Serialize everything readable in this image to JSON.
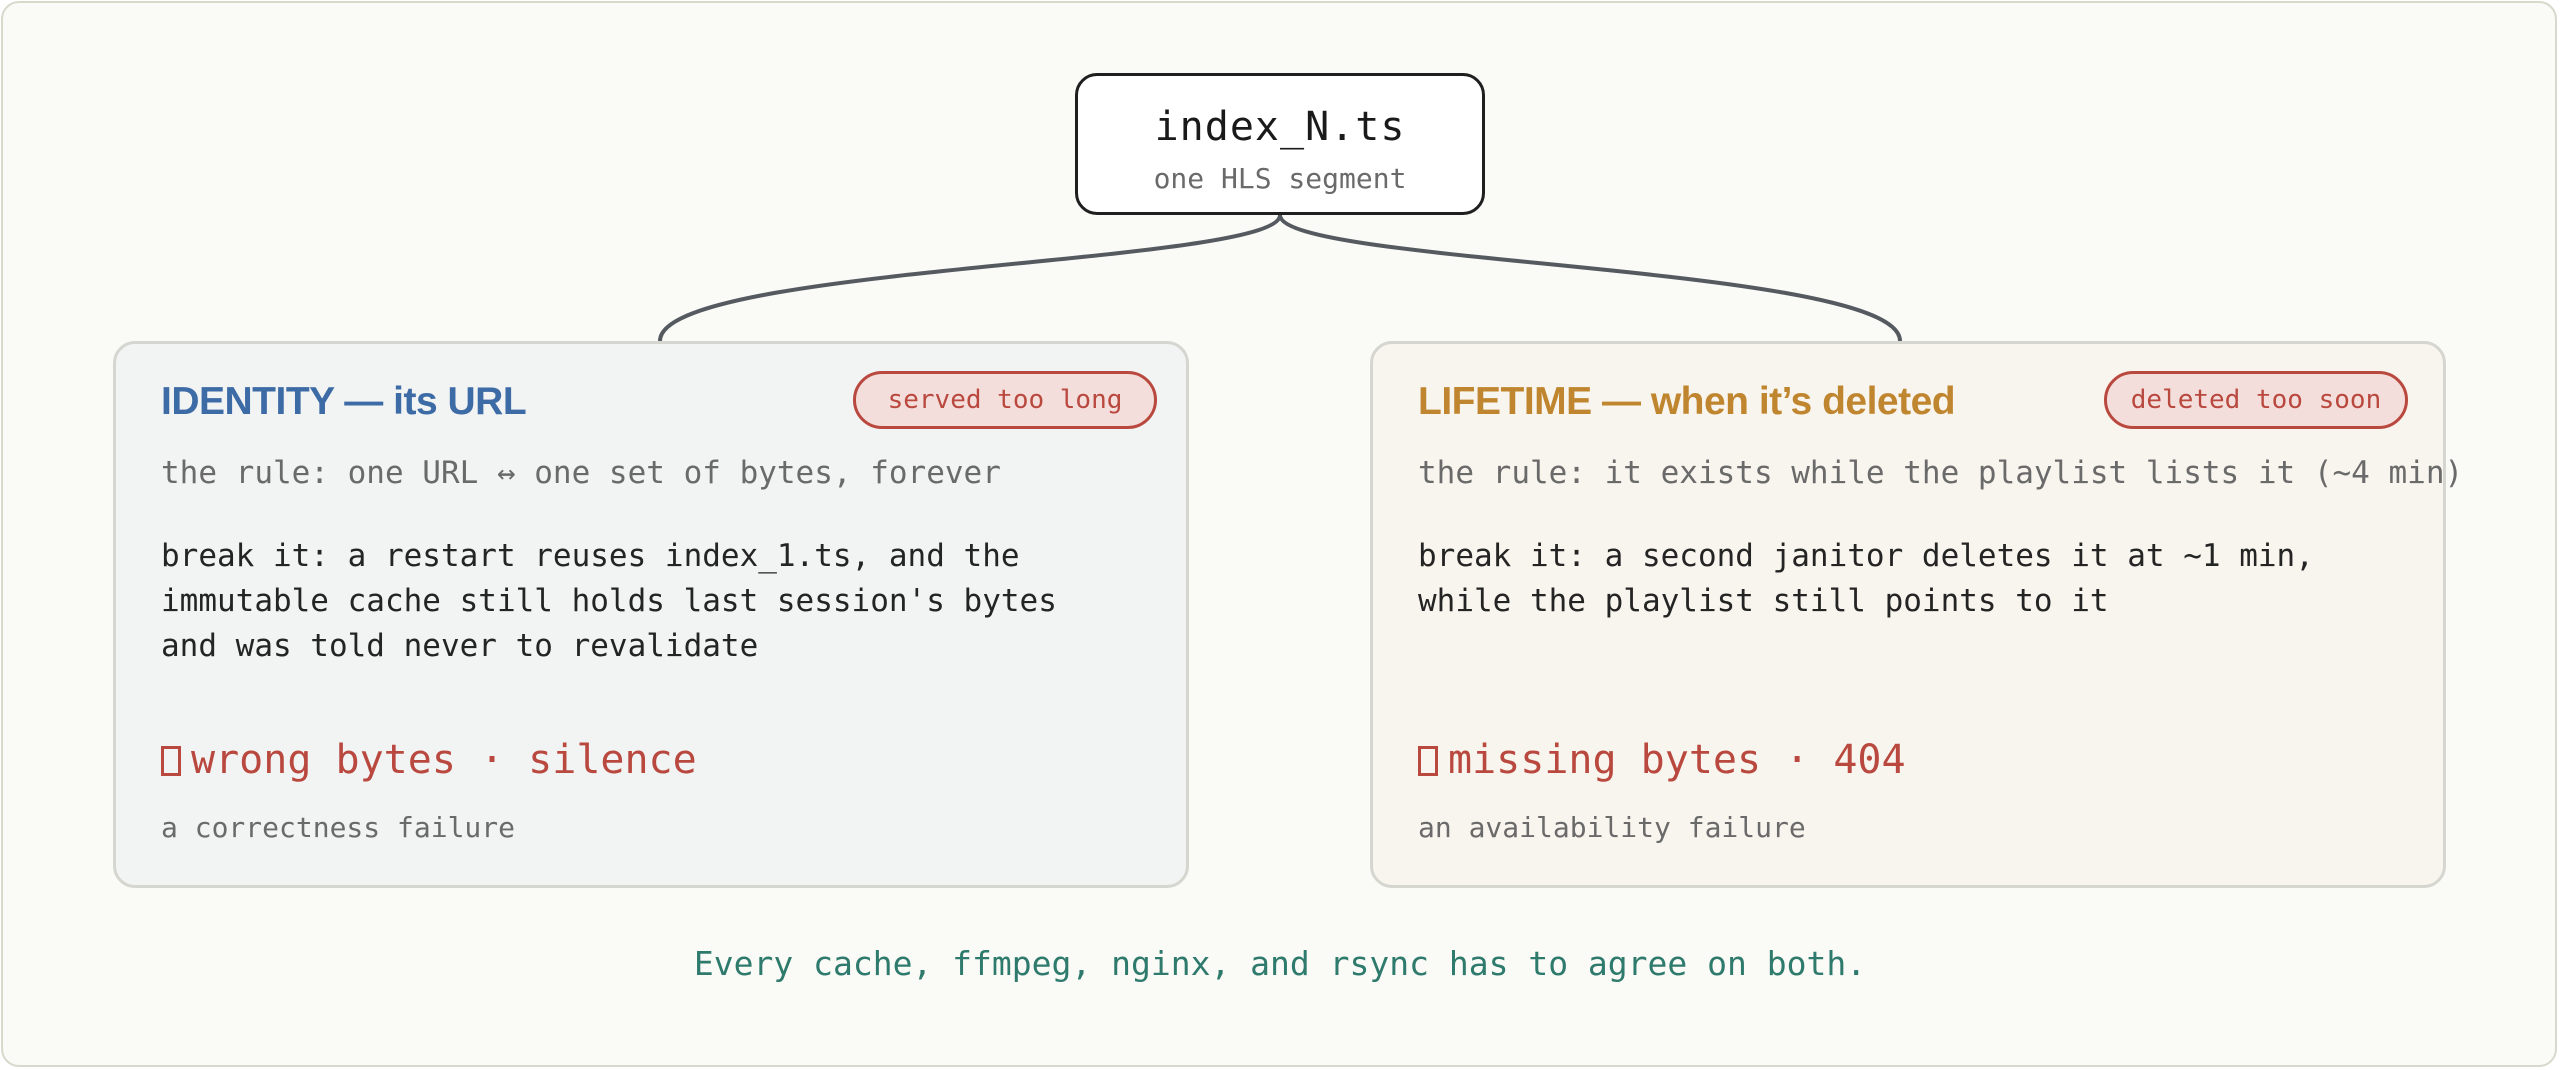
{
  "root": {
    "title": "index_N.ts",
    "subtitle": "one HLS segment"
  },
  "cards": [
    {
      "title": "IDENTITY — its URL",
      "accent_color": "#3d6ba6",
      "badge": "served too long",
      "rule": "the rule: one URL ↔ one set of bytes, forever",
      "break_lines": [
        "break it: a restart reuses index_1.ts, and the",
        "immutable cache still holds last session's bytes",
        "and was told never to revalidate"
      ],
      "outcome_icon": "box-glyph-icon",
      "outcome": "wrong bytes · silence",
      "failure_kind": "a correctness failure"
    },
    {
      "title": "LIFETIME — when it’s deleted",
      "accent_color": "#c0852f",
      "badge": "deleted too soon",
      "rule": "the rule: it exists while the playlist lists it (~4 min)",
      "break_lines": [
        "break it: a second janitor deletes it at ~1 min,",
        "while the playlist still points to it"
      ],
      "outcome_icon": "box-glyph-icon",
      "outcome": "missing bytes · 404",
      "failure_kind": "an availability failure"
    }
  ],
  "footer": "Every cache, ffmpeg, nginx, and rsync has to agree on both.",
  "colors": {
    "failure_red": "#b9483f",
    "footer_teal": "#2e7a6c",
    "connector": "#555a60"
  }
}
